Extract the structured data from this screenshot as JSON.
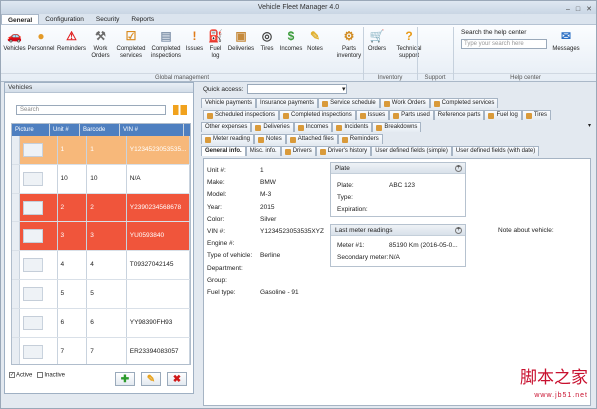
{
  "window": {
    "title": "Vehicle Fleet Manager 4.0",
    "controls": [
      "–",
      "□",
      "✕"
    ]
  },
  "menu": [
    "General",
    "Configuration",
    "Security",
    "Reports"
  ],
  "ribbon": {
    "buttons": [
      {
        "label": "Vehicles",
        "icon": "car-icon"
      },
      {
        "label": "Personnel",
        "icon": "person-icon"
      },
      {
        "label": "Reminders",
        "icon": "warning-icon"
      },
      {
        "label": "Work\nOrders",
        "icon": "worker-icon"
      },
      {
        "label": "Completed\nservices",
        "icon": "checkbox-icon"
      },
      {
        "label": "Completed\ninspections",
        "icon": "clipboard-icon"
      },
      {
        "label": "Issues",
        "icon": "exclamation-icon"
      },
      {
        "label": "Fuel\nlog",
        "icon": "fuel-icon"
      },
      {
        "label": "Deliveries",
        "icon": "box-icon"
      },
      {
        "label": "Tires",
        "icon": "tire-icon"
      },
      {
        "label": "Incomes",
        "icon": "money-icon"
      },
      {
        "label": "Notes",
        "icon": "note-icon"
      },
      {
        "label": "Parts\ninventory",
        "icon": "gears-icon"
      },
      {
        "label": "Orders",
        "icon": "cart-icon"
      },
      {
        "label": "Technical\nsupport",
        "icon": "question-icon"
      },
      {
        "label": "Messages",
        "icon": "chat-icon"
      }
    ],
    "groups": [
      "Global management",
      "Inventory",
      "Support",
      "Help center"
    ],
    "help": {
      "label": "Search the help center",
      "placeholder": "Type your search here"
    }
  },
  "left": {
    "title": "Vehicles",
    "search_placeholder": "Search",
    "columns": [
      "Picture",
      "Unit #",
      "Barcode",
      "VIN #"
    ],
    "rows": [
      {
        "unit": "1",
        "barcode": "1",
        "vin": "Y1234523053535...",
        "color": "#f7b87a"
      },
      {
        "unit": "10",
        "barcode": "10",
        "vin": "N/A",
        "color": "#ffffff"
      },
      {
        "unit": "2",
        "barcode": "2",
        "vin": "Y2390234568678",
        "color": "#f0553b"
      },
      {
        "unit": "3",
        "barcode": "3",
        "vin": "YU0593840",
        "color": "#f0553b"
      },
      {
        "unit": "4",
        "barcode": "4",
        "vin": "T09327042145",
        "color": "#ffffff"
      },
      {
        "unit": "5",
        "barcode": "5",
        "vin": "",
        "color": "#ffffff"
      },
      {
        "unit": "6",
        "barcode": "6",
        "vin": "YY98390FH93",
        "color": "#ffffff"
      },
      {
        "unit": "7",
        "barcode": "7",
        "vin": "ER23394083057",
        "color": "#ffffff"
      }
    ],
    "active": "Active",
    "inactive": "Inactive"
  },
  "right": {
    "quick_access": "Quick access:",
    "tabs_row1": [
      "Vehicle payments",
      "Insurance payments",
      "Service schedule",
      "Work Orders",
      "Completed services"
    ],
    "tabs_row2": [
      "Scheduled inspections",
      "Completed inspections",
      "Issues",
      "Parts used",
      "Reference parts",
      "Fuel log",
      "Tires"
    ],
    "tabs_row3": [
      "Other expenses",
      "Deliveries",
      "Incomes",
      "Incidents",
      "Breakdowns"
    ],
    "tabs_row4": [
      "Meter reading",
      "Notes",
      "Attached files",
      "Reminders"
    ],
    "tabs_row5": [
      "General info.",
      "Misc. info.",
      "Drivers",
      "Driver's history",
      "User defined fields (simple)",
      "User defined fields (with date)"
    ],
    "fields": [
      {
        "k": "Unit #:",
        "v": "1"
      },
      {
        "k": "Make:",
        "v": "BMW"
      },
      {
        "k": "Model:",
        "v": "M-3"
      },
      {
        "k": "Year:",
        "v": "2015"
      },
      {
        "k": "Color:",
        "v": "Silver"
      },
      {
        "k": "VIN #:",
        "v": "Y1234523053535XYZ"
      },
      {
        "k": "Engine #:",
        "v": ""
      },
      {
        "k": "Type of vehicle:",
        "v": "Berline"
      },
      {
        "k": "Department:",
        "v": ""
      },
      {
        "k": "Group:",
        "v": ""
      },
      {
        "k": "Fuel type:",
        "v": "Gasoline - 91"
      }
    ],
    "plate": {
      "title": "Plate",
      "plate_k": "Plate:",
      "plate_v": "ABC 123",
      "type_k": "Type:",
      "exp_k": "Expiration:"
    },
    "meter": {
      "title": "Last meter readings",
      "m1_k": "Meter #1:",
      "m1_v": "85190 Km (2016-05-0...",
      "sec_k": "Secondary meter:",
      "sec_v": "N/A"
    },
    "note": "Note about vehicle:"
  },
  "watermark": {
    "cn": "脚本之家",
    "url": "www.jb51.net"
  }
}
